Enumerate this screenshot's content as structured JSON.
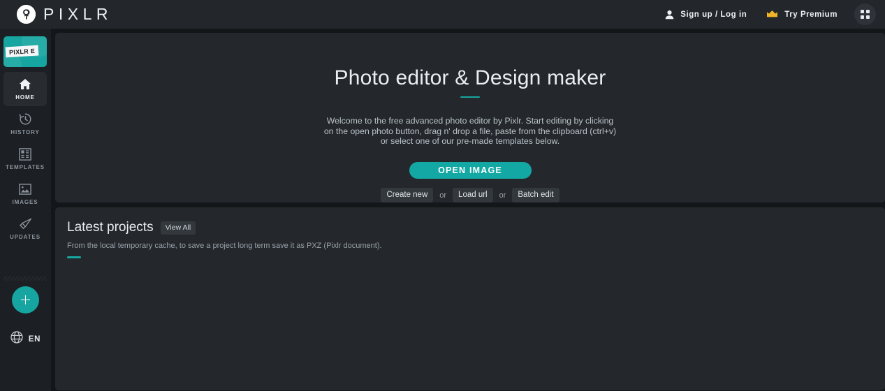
{
  "topbar": {
    "brand_name": "PIXLR",
    "brand_icon": "pixlr-logo-icon",
    "signup_label": "Sign up / Log in",
    "signup_icon": "user-icon",
    "premium_label": "Try Premium",
    "premium_icon": "crown-icon",
    "apps_icon": "grid-apps-icon"
  },
  "sidebar": {
    "logo_tile_label": "PIXLR E",
    "items": [
      {
        "label": "HOME",
        "icon": "home-icon",
        "active": true
      },
      {
        "label": "HISTORY",
        "icon": "history-clock-icon",
        "active": false
      },
      {
        "label": "TEMPLATES",
        "icon": "templates-layout-icon",
        "active": false
      },
      {
        "label": "IMAGES",
        "icon": "image-picture-icon",
        "active": false
      },
      {
        "label": "UPDATES",
        "icon": "megaphone-icon",
        "active": false
      }
    ],
    "add_icon": "plus-icon",
    "language_code": "EN",
    "language_icon": "globe-icon"
  },
  "hero": {
    "title": "Photo editor & Design maker",
    "description": "Welcome to the free advanced photo editor by Pixlr. Start editing by clicking on the open photo button, drag n' drop a file, paste from the clipboard (ctrl+v) or select one of our pre-made templates below.",
    "open_button_label": "OPEN IMAGE",
    "alt_actions": [
      {
        "label": "Create new"
      },
      {
        "label": "Load url"
      },
      {
        "label": "Batch edit"
      }
    ],
    "separator_label": "or"
  },
  "projects": {
    "title": "Latest projects",
    "view_all_label": "View All",
    "subtitle": "From the local temporary cache, to save a project long term save it as PXZ (Pixlr document)."
  },
  "colors": {
    "accent": "#16a5a0",
    "topbar_bg": "#23262b",
    "sidebar_bg": "#1c1f23",
    "panel_bg": "#24282c",
    "page_bg": "#14171a",
    "premium_gold": "#f0b427"
  }
}
